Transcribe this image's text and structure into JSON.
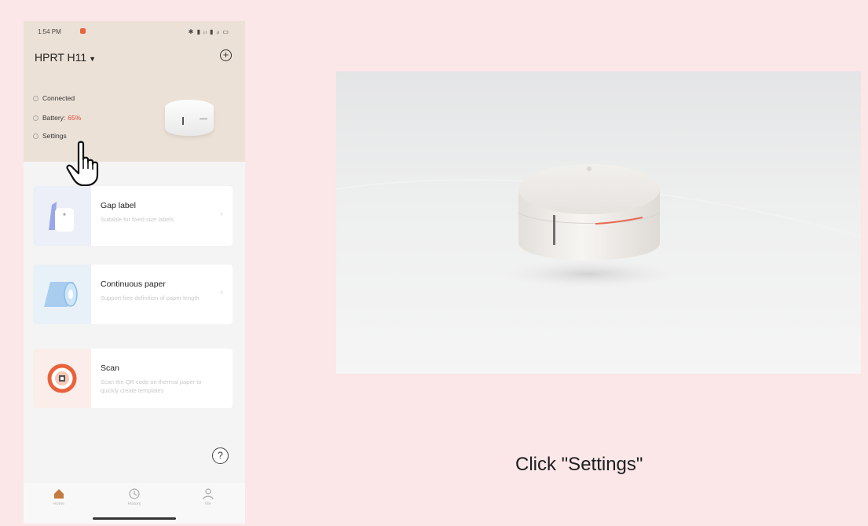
{
  "phone": {
    "status_bar": {
      "time": "1:54 PM",
      "icons": "✱ ▮ ᵢₗ ▮ ᵢₗ ▭"
    },
    "device_name": "HPRT H11",
    "info": {
      "connected": "Connected",
      "battery_label": "Battery:",
      "battery_value": "65%",
      "settings": "Settings"
    },
    "cards": [
      {
        "title": "Gap label",
        "description": "Suitable for fixed size labels"
      },
      {
        "title": "Continuous paper",
        "description": "Support free definition of paper length"
      },
      {
        "title": "Scan",
        "description": "Scan the QR code on thermal paper to quickly create templates"
      }
    ],
    "tabs": [
      {
        "label": "Home",
        "icon": "home-icon"
      },
      {
        "label": "History",
        "icon": "clock-icon"
      },
      {
        "label": "Me",
        "icon": "person-icon"
      }
    ]
  },
  "caption": "Click \"Settings\"",
  "colors": {
    "background": "#fbe6e8",
    "header": "#ece1d6",
    "battery": "#e0473a",
    "accent_scan": "#e8623c"
  }
}
